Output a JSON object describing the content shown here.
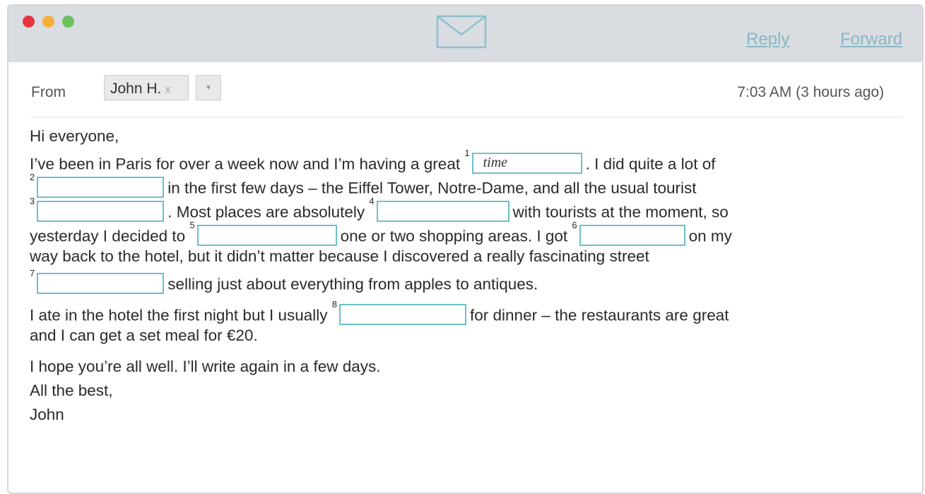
{
  "toolbar": {
    "reply_label": "Reply",
    "forward_label": "Forward",
    "icon": "envelope-icon"
  },
  "header": {
    "from_label": "From",
    "sender": "John H.",
    "remove_glyph": "x",
    "dropdown_glyph": "▾",
    "timestamp": "7:03 AM (3 hours ago)"
  },
  "email": {
    "greeting": "Hi everyone,",
    "p1": {
      "t1": "I’ve been in Paris for over a week now and I’m having a great",
      "t2": ". I did quite a lot of",
      "t3": "in the first few days – the Eiffel Tower, Notre-Dame, and all the usual tourist",
      "t4": ". Most places are absolutely",
      "t5": "with tourists at the moment, so",
      "t6": "yesterday I decided to",
      "t7": "one or two shopping areas. I got",
      "t8": "on my",
      "t9": "way back to the hotel, but it didn’t matter because I discovered a really fascinating street",
      "t10": "selling just about everything from apples to antiques."
    },
    "p2": {
      "t1": "I ate in the hotel the first night but I usually",
      "t2": "for dinner – the restaurants are great",
      "t3": "and I can get a set meal for €20."
    },
    "closing": {
      "l1": "I hope you’re all well. I’ll write again in a few days.",
      "l2": "All the best,",
      "l3": "John"
    }
  },
  "gaps": [
    {
      "number": "1",
      "value": "time"
    },
    {
      "number": "2",
      "value": ""
    },
    {
      "number": "3",
      "value": ""
    },
    {
      "number": "4",
      "value": ""
    },
    {
      "number": "5",
      "value": ""
    },
    {
      "number": "6",
      "value": ""
    },
    {
      "number": "7",
      "value": ""
    },
    {
      "number": "8",
      "value": ""
    }
  ],
  "colors": {
    "titlebar": "#d9dde1",
    "link": "#88b7c4",
    "gap_border": "#6cc0cd"
  }
}
